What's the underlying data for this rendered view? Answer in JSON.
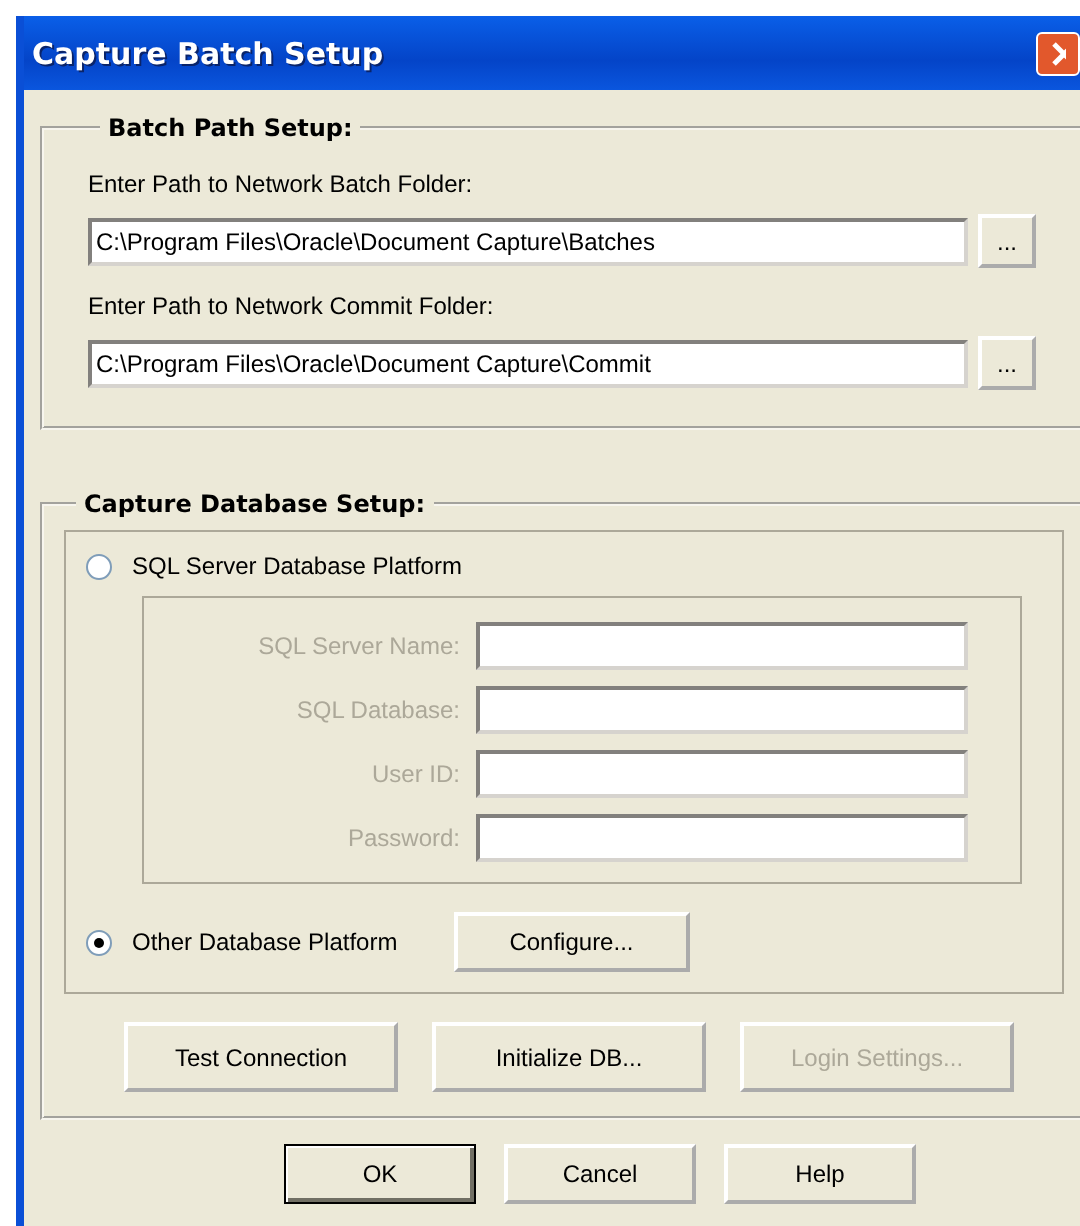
{
  "window": {
    "title": "Capture Batch Setup"
  },
  "batch_path_setup": {
    "title": "Batch Path Setup:",
    "fields": [
      {
        "label": "Enter Path to Network Batch Folder:",
        "value": "C:\\Program Files\\Oracle\\Document Capture\\Batches",
        "button": "..."
      },
      {
        "label": "Enter Path to Network Commit Folder:",
        "value": "C:\\Program Files\\Oracle\\Document Capture\\Commit",
        "button": "..."
      }
    ]
  },
  "capture_database_setup": {
    "title": "Capture Database Setup:",
    "sql_option": {
      "label": "SQL Server Database Platform",
      "selected": false
    },
    "sql_fields": [
      {
        "label": "SQL Server Name:",
        "disabled": true
      },
      {
        "label": "SQL Database:",
        "disabled": true
      },
      {
        "label": "User ID:",
        "disabled": true
      },
      {
        "label": "Password:",
        "disabled": true
      }
    ],
    "other_option": {
      "label": "Other Database Platform",
      "selected": true
    },
    "configure_button": "Configure...",
    "buttons": [
      {
        "label": "Test Connection",
        "disabled": false
      },
      {
        "label": "Initialize DB...",
        "disabled": false
      },
      {
        "label": "Login Settings...",
        "disabled": true
      }
    ]
  },
  "buttons": [
    {
      "label": "OK",
      "default": true
    },
    {
      "label": "Cancel",
      "default": false
    },
    {
      "label": "Help",
      "default": false
    }
  ]
}
